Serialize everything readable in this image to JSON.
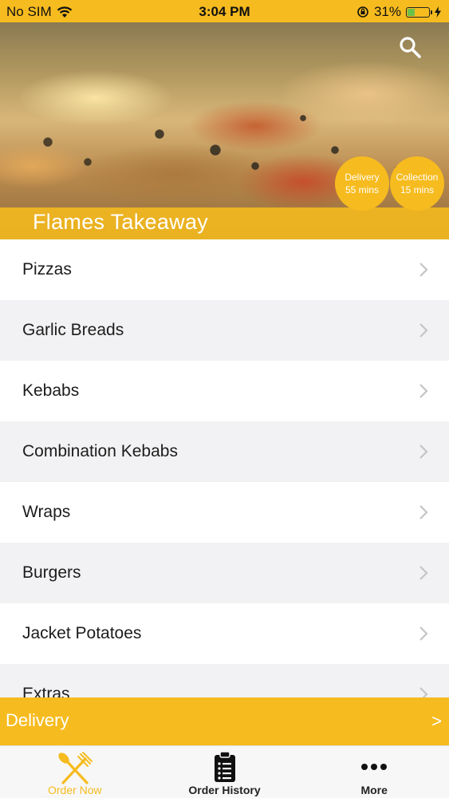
{
  "status_bar": {
    "carrier": "No SIM",
    "time": "3:04 PM",
    "battery": "31%"
  },
  "hero": {
    "restaurant_name": "Flames Takeaway",
    "delivery_badge": {
      "label": "Delivery",
      "time": "55 mins"
    },
    "collection_badge": {
      "label": "Collection",
      "time": "15 mins"
    }
  },
  "menu": {
    "items": [
      {
        "label": "Pizzas"
      },
      {
        "label": "Garlic Breads"
      },
      {
        "label": "Kebabs"
      },
      {
        "label": "Combination Kebabs"
      },
      {
        "label": "Wraps"
      },
      {
        "label": "Burgers"
      },
      {
        "label": "Jacket Potatoes"
      },
      {
        "label": "Extras"
      }
    ]
  },
  "delivery_bar": {
    "label": "Delivery",
    "arrow": ">"
  },
  "tab_bar": {
    "tabs": [
      {
        "label": "Order Now",
        "icon": "fork-knife-icon",
        "active": true
      },
      {
        "label": "Order History",
        "icon": "clipboard-icon",
        "active": false
      },
      {
        "label": "More",
        "icon": "more-dots-icon",
        "active": false
      }
    ]
  },
  "colors": {
    "accent": "#f6bb1e",
    "battery_fill": "#6cc04a"
  }
}
